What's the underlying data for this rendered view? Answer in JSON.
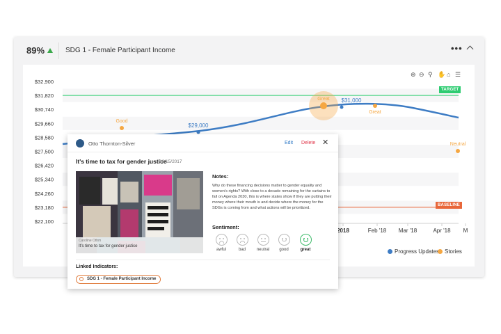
{
  "header": {
    "score": "89%",
    "title": "SDG 1 - Female Participant Income",
    "more_icon": "ellipsis-icon",
    "collapse_icon": "chevron-up-icon",
    "score_trend_color": "#3aa84a"
  },
  "toolbar": {
    "icons": [
      "zoom-in-icon",
      "zoom-out-icon",
      "magnify-icon",
      "pan-hand-icon",
      "home-icon",
      "menu-icon"
    ]
  },
  "chart_data": {
    "type": "line",
    "y_ticks": [
      "$32,900",
      "$31,820",
      "$30,740",
      "$29,660",
      "$28,580",
      "$27,500",
      "$26,420",
      "$25,340",
      "$24,260",
      "$23,180",
      "$22,100"
    ],
    "ylim": [
      22100,
      32900
    ],
    "x_ticks": [
      "2018",
      "Feb '18",
      "Mar '18",
      "Apr '18",
      "M"
    ],
    "series": [
      {
        "name": "Progress Updates",
        "color": "#3d7cc4",
        "points": [
          {
            "label": "$29,000",
            "value": 29000
          },
          {
            "label": "$31,000",
            "value": 31000
          }
        ]
      },
      {
        "name": "Stories",
        "color": "#f5a742",
        "points": [
          {
            "label": "Good"
          },
          {
            "label": "Great"
          },
          {
            "label": "Great"
          },
          {
            "label": "Neutral"
          }
        ]
      }
    ],
    "reference_lines": [
      {
        "label": "TARGET",
        "value": 31820,
        "color": "#2ecc71"
      },
      {
        "label": "BASELINE",
        "value": 23180,
        "color": "#e8673a"
      }
    ],
    "legend_placement": "bottom-right",
    "grid": true
  },
  "story": {
    "author": "Otto Thornton-Silver",
    "edit_label": "Edit",
    "delete_label": "Delete",
    "close_icon": "close-icon",
    "title": "It's time to tax for gender justice",
    "date": "12/15/2017",
    "photo_credit": "Caroline Othm",
    "photo_caption": "It's time to tax for gender justice",
    "notes_label": "Notes:",
    "notes": "Why do these financing decisions matter to gender equality and women's rights? With close to a decade remaining for the curtains to fall on Agenda 2030, this is where states show if they are putting their money where their mouth is and decide where the money for the SDGs is coming from and what actions will be prioritized.",
    "sentiment_label": "Sentiment:",
    "sentiments": [
      "awful",
      "bad",
      "neutral",
      "good",
      "great"
    ],
    "selected_sentiment": "great",
    "linked_label": "Linked Indicators:",
    "linked_chip": "SDG 1 - Female Participant Income"
  }
}
